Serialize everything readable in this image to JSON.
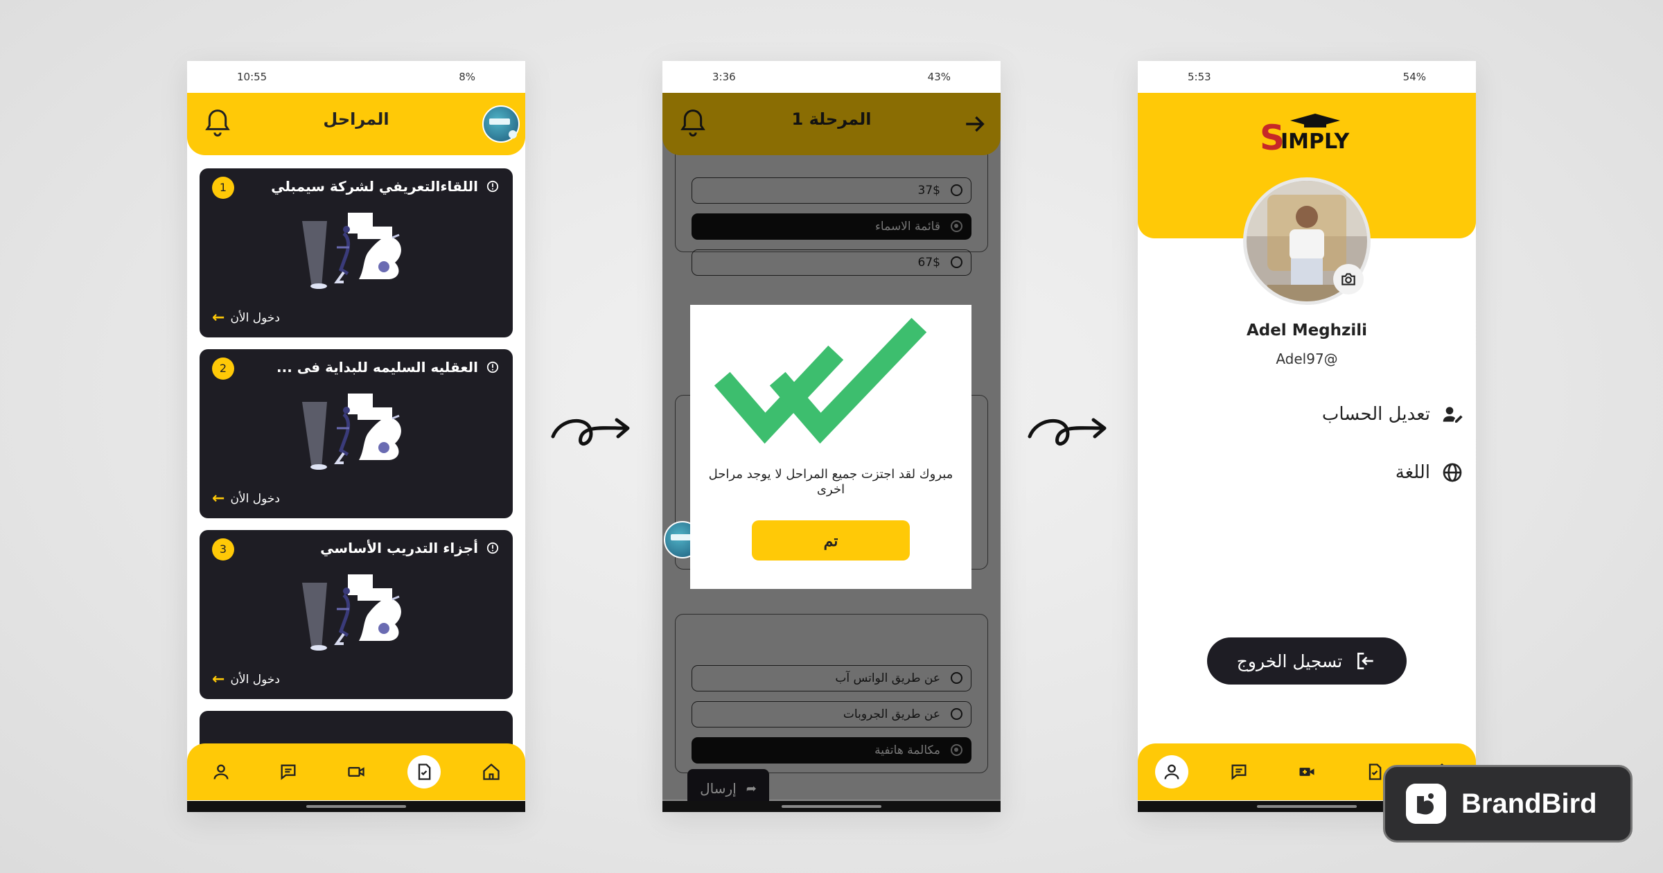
{
  "phone1": {
    "status": {
      "time": "10:55",
      "battery": "8%"
    },
    "header_title": "المراحل",
    "cards": [
      {
        "num": "1",
        "title": "اللقاءالتعريفي لشركة سيمبلي",
        "enter": "دخول الأن"
      },
      {
        "num": "2",
        "title": "العقليه السليمه للبداية فى ...",
        "enter": "دخول الأن"
      },
      {
        "num": "3",
        "title": "أجزاء التدريب الأساسي",
        "enter": "دخول الأن"
      }
    ]
  },
  "phone2": {
    "status": {
      "time": "3:36",
      "battery": "43%"
    },
    "header_title": "المرحلة 1",
    "question1_options": [
      "37$",
      "قائمة الاسماء",
      "67$"
    ],
    "question2_options": [
      "عن طريق الواتس آب",
      "عن طريق الجروبات",
      "مكالمة هاتفية"
    ],
    "send_label": "إرسال",
    "modal": {
      "message": "مبروك لقد اجتزت جميع المراحل لا يوجد مراحل اخرى",
      "ok_label": "تم"
    }
  },
  "phone3": {
    "status": {
      "time": "5:53",
      "battery": "54%"
    },
    "name": "Adel Meghzili",
    "handle": "Adel97@",
    "menu": [
      {
        "label": "تعديل الحساب",
        "icon": "user-edit-icon"
      },
      {
        "label": "اللغة",
        "icon": "globe-icon"
      }
    ],
    "logout_label": "تسجيل الخروج"
  },
  "brand": {
    "name": "BrandBird"
  },
  "colors": {
    "accent": "#FFC907",
    "card": "#1e1d24",
    "success": "#3DBE6E"
  }
}
